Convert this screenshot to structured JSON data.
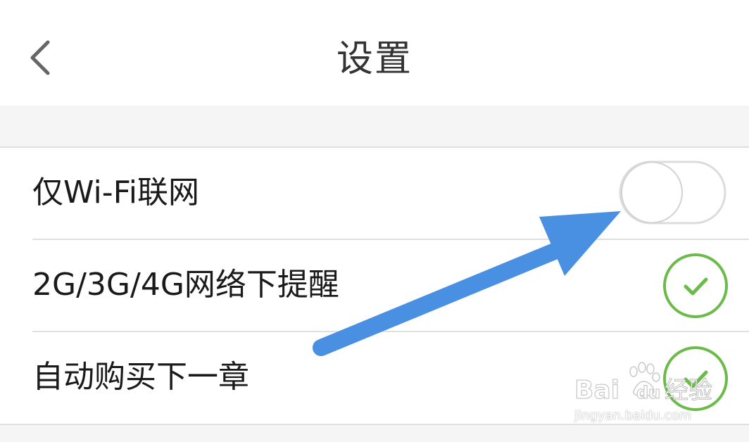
{
  "header": {
    "title": "设置",
    "back_icon": "chevron-left-icon"
  },
  "settings": [
    {
      "label": "仅Wi-Fi联网",
      "control": "toggle",
      "on": false
    },
    {
      "label": "2G/3G/4G网络下提醒",
      "control": "checkmark",
      "checked": true
    },
    {
      "label": "自动购买下一章",
      "control": "checkmark",
      "checked": true
    }
  ],
  "annotation": {
    "type": "arrow",
    "color": "#4a90e2",
    "points_to": "仅Wi-Fi联网 toggle"
  },
  "watermark": {
    "brand": "Baidu经验",
    "url": "jingyan.baidu.com"
  },
  "colors": {
    "check_green": "#6cbb4a",
    "toggle_off_border": "#dcdcdc",
    "section_bg": "#f5f5f5",
    "divider": "#e0e0e0"
  }
}
